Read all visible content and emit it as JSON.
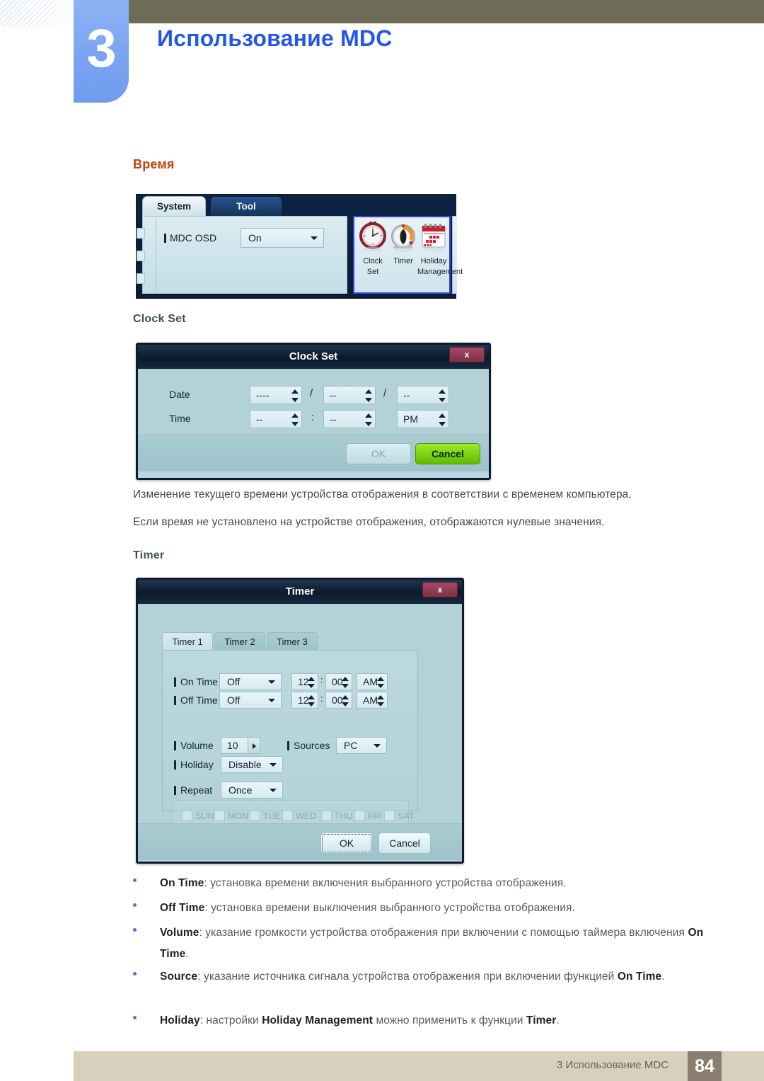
{
  "header": {
    "chapter_number": "3",
    "chapter_title": "Использование MDC"
  },
  "section": {
    "heading": "Время",
    "clock_set_heading": "Clock Set",
    "timer_heading": "Timer",
    "para1": "Изменение текущего времени устройства отображения в соответствии с временем компьютера.",
    "para2": "Если время не установлено на устройстве отображения, отображаются нулевые значения."
  },
  "system_panel": {
    "tabs": [
      {
        "label": "System",
        "selected": true
      },
      {
        "label": "Tool",
        "selected": false
      }
    ],
    "osd": {
      "label": "MDC OSD",
      "value": "On"
    },
    "icons": [
      {
        "name": "clock-set-icon",
        "caption_line1": "Clock",
        "caption_line2": "Set"
      },
      {
        "name": "timer-icon",
        "caption_line1": "Timer",
        "caption_line2": ""
      },
      {
        "name": "holiday-management-icon",
        "caption_line1": "Holiday",
        "caption_line2": "Management"
      }
    ],
    "selection_color": "#3f3fe0"
  },
  "clock_set_dialog": {
    "title": "Clock Set",
    "close_label": "x",
    "date_label": "Date",
    "time_label": "Time",
    "date_year": "----",
    "date_month": "--",
    "date_day": "--",
    "date_sep1": "/",
    "date_sep2": "/",
    "time_hour": "--",
    "time_minute": "--",
    "time_meridiem": "PM",
    "time_sep": ":",
    "ok_label": "OK",
    "cancel_label": "Cancel"
  },
  "timer_dialog": {
    "title": "Timer",
    "close_label": "x",
    "tabs": [
      {
        "label": "Timer 1",
        "selected": true
      },
      {
        "label": "Timer 2",
        "selected": false
      },
      {
        "label": "Timer 3",
        "selected": false
      }
    ],
    "on_time": {
      "label": "On Time",
      "mode": "Off",
      "hour": "12",
      "minute": "00",
      "meridiem": "AM",
      "sep": ":"
    },
    "off_time": {
      "label": "Off Time",
      "mode": "Off",
      "hour": "12",
      "minute": "00",
      "meridiem": "AM",
      "sep": ":"
    },
    "volume": {
      "label": "Volume",
      "value": "10"
    },
    "sources": {
      "label": "Sources",
      "value": "PC"
    },
    "holiday": {
      "label": "Holiday",
      "value": "Disable"
    },
    "repeat": {
      "label": "Repeat",
      "value": "Once"
    },
    "days": [
      "SUN",
      "MON",
      "TUE",
      "WED",
      "THU",
      "FRI",
      "SAT"
    ],
    "ok_label": "OK",
    "cancel_label": "Cancel"
  },
  "bullets": [
    {
      "term": "On Time",
      "rest": ": установка времени включения выбранного устройства отображения."
    },
    {
      "term": "Off Time",
      "rest": ": установка времени выключения выбранного устройства отображения."
    },
    {
      "term": "Volume",
      "rest": ": указание громкости устройства отображения при включении с помощью таймера включения ",
      "term2": "On Time",
      "tail": "."
    },
    {
      "term": "Source",
      "rest": ": указание источника сигнала устройства отображения при включении функцией ",
      "term2": "On Time",
      "tail": "."
    },
    {
      "term": "Holiday",
      "rest": ": настройки ",
      "term2": "Holiday Management",
      "rest2": " можно применить к функции ",
      "term3": "Timer",
      "tail": "."
    }
  ],
  "footer": {
    "text": "3 Использование MDC",
    "page": "84"
  }
}
